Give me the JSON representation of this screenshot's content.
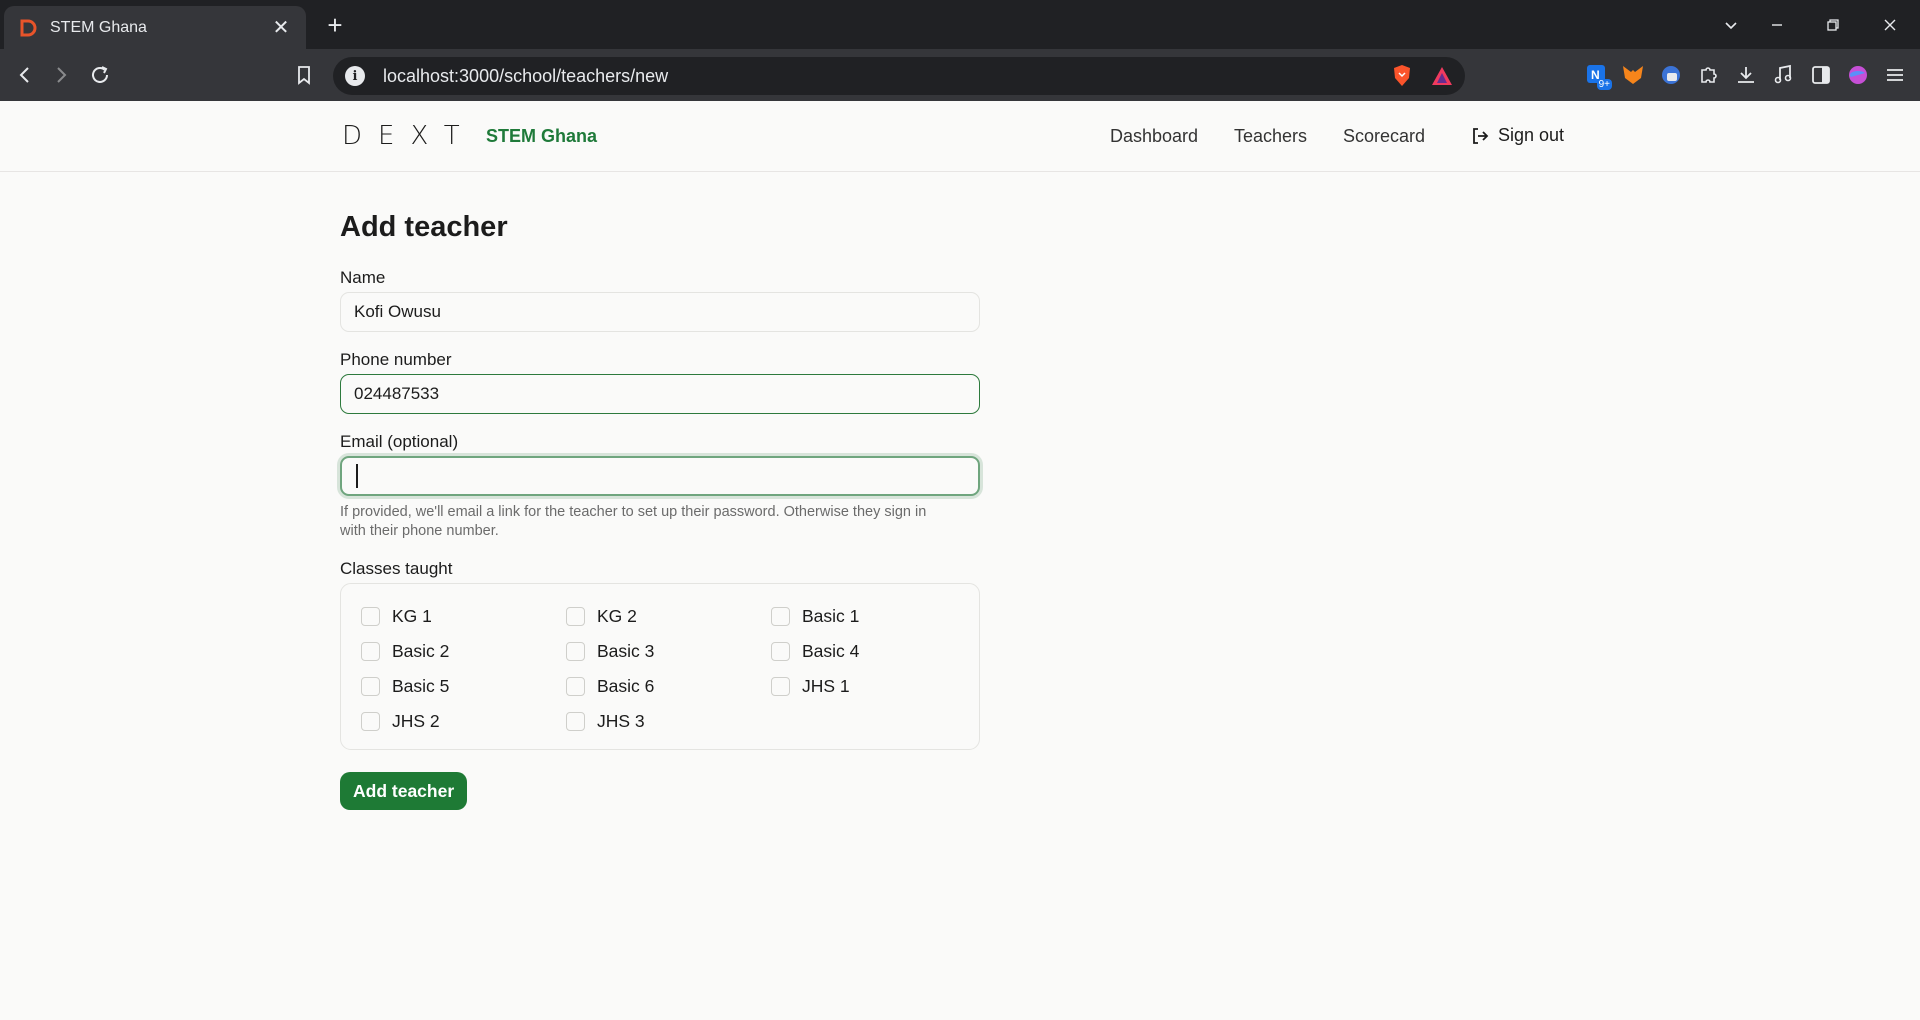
{
  "browser": {
    "tab_title": "STEM Ghana",
    "url": "localhost:3000/school/teachers/new",
    "notification_badge": "9+"
  },
  "header": {
    "logo": "DEXT",
    "brand": "STEM Ghana",
    "nav": [
      {
        "label": "Dashboard"
      },
      {
        "label": "Teachers"
      },
      {
        "label": "Scorecard"
      }
    ],
    "signout_label": "Sign out"
  },
  "form": {
    "title": "Add teacher",
    "name": {
      "label": "Name",
      "value": "Kofi Owusu"
    },
    "phone": {
      "label": "Phone number",
      "value": "024487533"
    },
    "email": {
      "label": "Email (optional)",
      "value": "",
      "help_line1": "If provided, we'll email a link for the teacher to set up their password. Otherwise they sign in",
      "help_line2": "with their phone number."
    },
    "classes_label": "Classes taught",
    "classes": [
      {
        "label": "KG 1",
        "checked": false
      },
      {
        "label": "KG 2",
        "checked": false
      },
      {
        "label": "Basic 1",
        "checked": false
      },
      {
        "label": "Basic 2",
        "checked": false
      },
      {
        "label": "Basic 3",
        "checked": false
      },
      {
        "label": "Basic 4",
        "checked": false
      },
      {
        "label": "Basic 5",
        "checked": false
      },
      {
        "label": "Basic 6",
        "checked": false
      },
      {
        "label": "JHS 1",
        "checked": false
      },
      {
        "label": "JHS 2",
        "checked": false
      },
      {
        "label": "JHS 3",
        "checked": false
      }
    ],
    "submit_label": "Add teacher"
  },
  "colors": {
    "brand_green": "#1f7a3a",
    "button_green": "#1e7a35",
    "focus_ring": "#6fa57e"
  }
}
